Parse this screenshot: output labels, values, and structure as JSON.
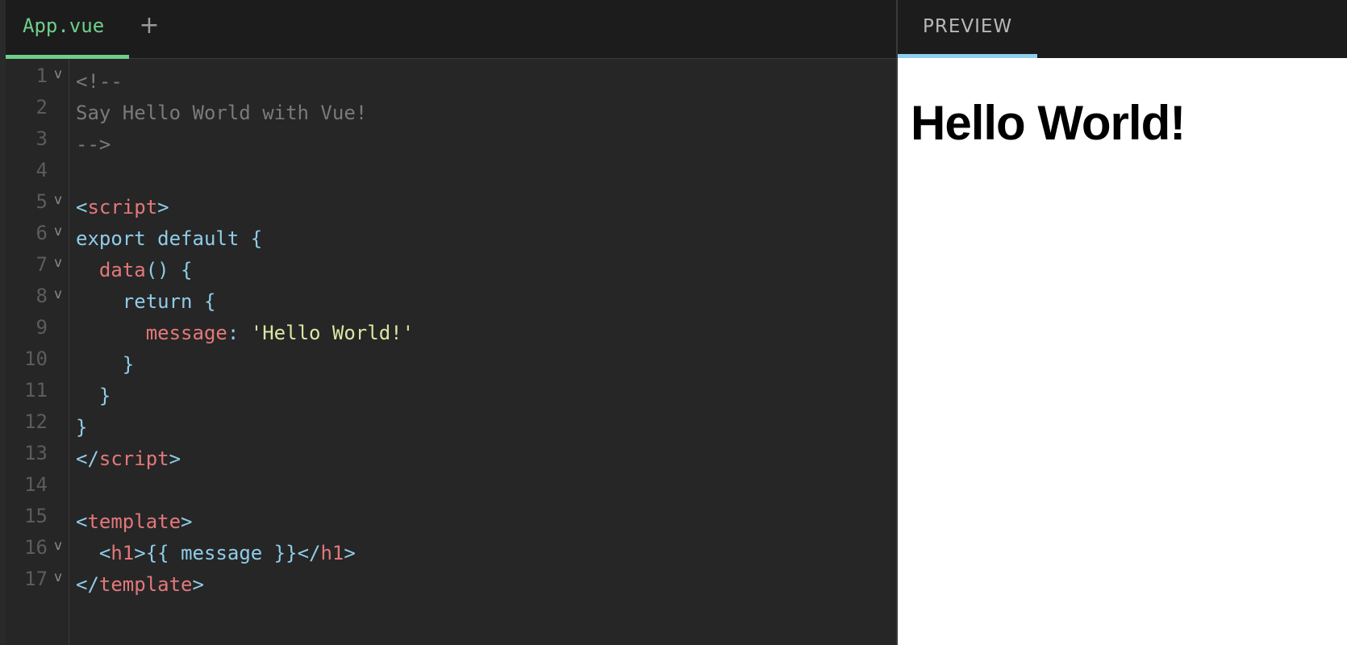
{
  "editor": {
    "file_tab": "App.vue",
    "add_tab_label": "+",
    "line_numbers": [
      "1",
      "2",
      "3",
      "4",
      "5",
      "6",
      "7",
      "8",
      "9",
      "10",
      "11",
      "12",
      "13",
      "14",
      "15",
      "16",
      "17"
    ],
    "fold_marker": "v",
    "code": {
      "l1": "<!--",
      "l2": "Say Hello World with Vue!",
      "l3": "-->",
      "lt": "<",
      "gt": ">",
      "close_lt": "</",
      "script": "script",
      "export_default": "export default {",
      "indent2": "  ",
      "indent4": "    ",
      "indent6": "      ",
      "data_fn": "data",
      "data_rest": "() {",
      "return_line": "return {",
      "message_key": "message",
      "colon": ": ",
      "message_val": "'Hello World!'",
      "close_brace": "}",
      "template": "template",
      "h1": "h1",
      "mustache": "{{ message }}"
    }
  },
  "preview": {
    "tab_label": "PREVIEW",
    "heading": "Hello World!"
  },
  "colors": {
    "accent_green": "#6fcf8a",
    "accent_blue": "#8fd0ee",
    "editor_bg": "#262626"
  }
}
